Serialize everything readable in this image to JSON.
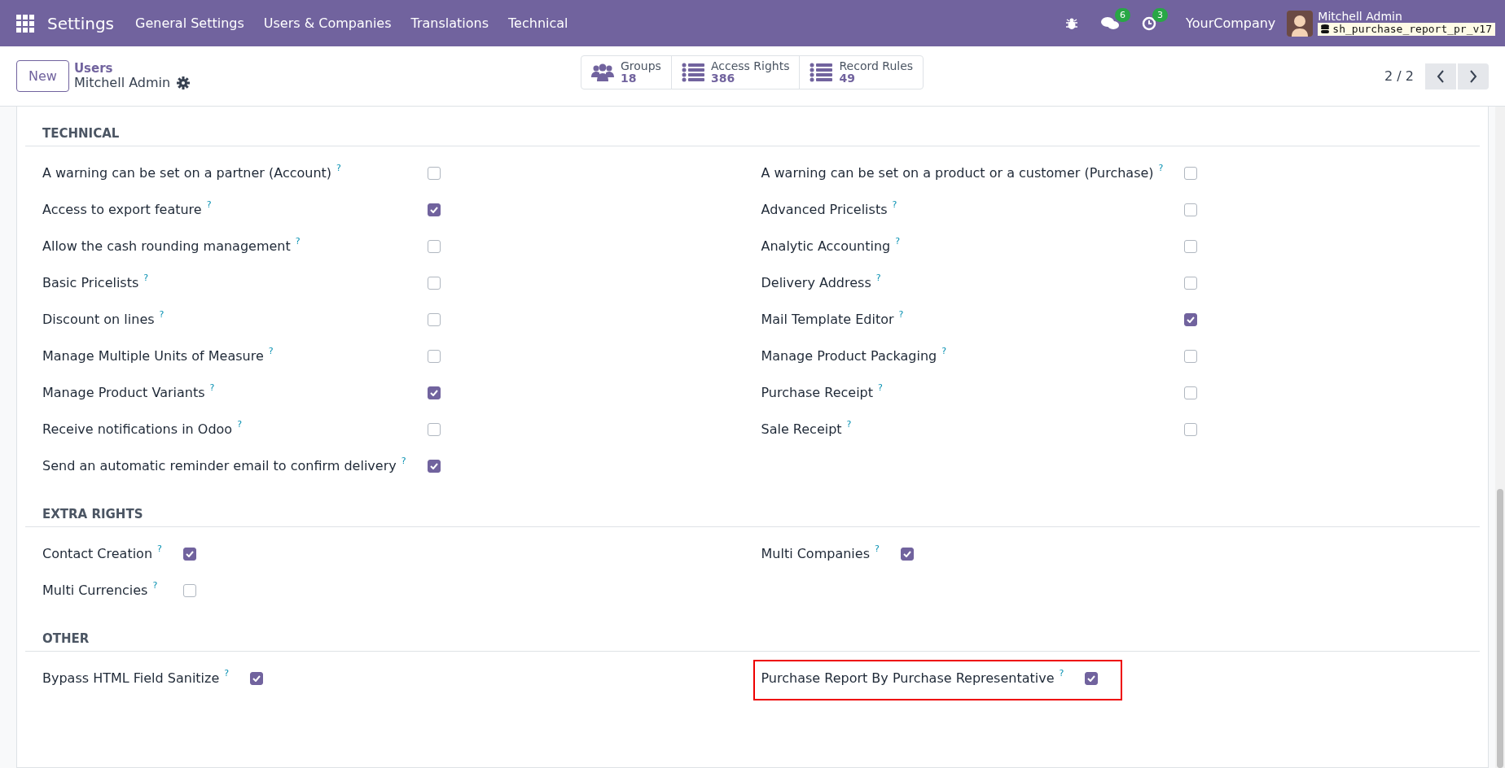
{
  "navbar": {
    "app_name": "Settings",
    "menus": [
      "General Settings",
      "Users & Companies",
      "Translations",
      "Technical"
    ],
    "messages_count": "6",
    "activities_count": "3",
    "company": "YourCompany",
    "user_name": "Mitchell Admin",
    "database": "sh_purchase_report_pr_v17"
  },
  "control_panel": {
    "new_button": "New",
    "breadcrumb_parent": "Users",
    "breadcrumb_current": "Mitchell Admin",
    "smart_buttons": [
      {
        "kind": "groups",
        "label": "Groups",
        "count": "18"
      },
      {
        "kind": "list",
        "label": "Access Rights",
        "count": "386"
      },
      {
        "kind": "list",
        "label": "Record Rules",
        "count": "49"
      }
    ],
    "pager": "2 / 2"
  },
  "sections": [
    {
      "title": "TECHNICAL",
      "left": [
        {
          "label": "A warning can be set on a partner (Account)",
          "help": "?",
          "checked": false
        },
        {
          "label": "Access to export feature",
          "help": "?",
          "checked": true
        },
        {
          "label": "Allow the cash rounding management",
          "help": "?",
          "checked": false
        },
        {
          "label": "Basic Pricelists",
          "help": "?",
          "checked": false
        },
        {
          "label": "Discount on lines",
          "help": "?",
          "checked": false
        },
        {
          "label": "Manage Multiple Units of Measure",
          "help": "?",
          "checked": false
        },
        {
          "label": "Manage Product Variants",
          "help": "?",
          "checked": true
        },
        {
          "label": "Receive notifications in Odoo",
          "help": "?",
          "checked": false
        },
        {
          "label": "Send an automatic reminder email to confirm delivery",
          "help": "?",
          "checked": true
        }
      ],
      "right": [
        {
          "label": "A warning can be set on a product or a customer (Purchase)",
          "help": "?",
          "checked": false
        },
        {
          "label": "Advanced Pricelists",
          "help": "?",
          "checked": false
        },
        {
          "label": "Analytic Accounting",
          "help": "?",
          "checked": false
        },
        {
          "label": "Delivery Address",
          "help": "?",
          "checked": false
        },
        {
          "label": "Mail Template Editor",
          "help": "?",
          "checked": true
        },
        {
          "label": "Manage Product Packaging",
          "help": "?",
          "checked": false
        },
        {
          "label": "Purchase Receipt",
          "help": "?",
          "checked": false
        },
        {
          "label": "Sale Receipt",
          "help": "?",
          "checked": false
        }
      ]
    },
    {
      "title": "EXTRA RIGHTS",
      "left": [
        {
          "label": "Contact Creation",
          "help": "?",
          "checked": true
        },
        {
          "label": "Multi Currencies",
          "help": "?",
          "checked": false
        }
      ],
      "right": [
        {
          "label": "Multi Companies",
          "help": "?",
          "checked": true
        }
      ]
    },
    {
      "title": "OTHER",
      "left": [
        {
          "label": "Bypass HTML Field Sanitize",
          "help": "?",
          "checked": true
        }
      ],
      "right": [
        {
          "label": "Purchase Report By Purchase Representative",
          "help": "?",
          "checked": true,
          "highlighted": true
        }
      ]
    }
  ]
}
